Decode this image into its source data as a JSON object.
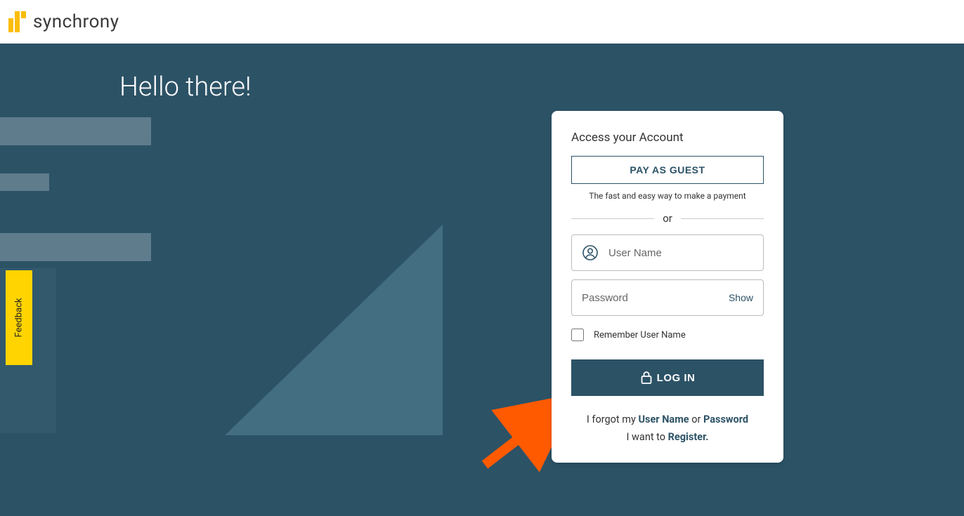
{
  "header": {
    "brand": "synchrony"
  },
  "hero": {
    "greeting": "Hello there!"
  },
  "feedback": {
    "label": "Feedback"
  },
  "card": {
    "title": "Access your Account",
    "guest_button": "PAY AS GUEST",
    "guest_subtext": "The fast and easy way to make a payment",
    "or_text": "or",
    "username_placeholder": "User Name",
    "password_placeholder": "Password",
    "show_label": "Show",
    "remember_label": "Remember User Name",
    "login_button": "LOG IN",
    "forgot_prefix": "I forgot my ",
    "forgot_username": "User Name",
    "forgot_or": " or ",
    "forgot_password": "Password",
    "register_prefix": "I want to ",
    "register_link": "Register."
  }
}
